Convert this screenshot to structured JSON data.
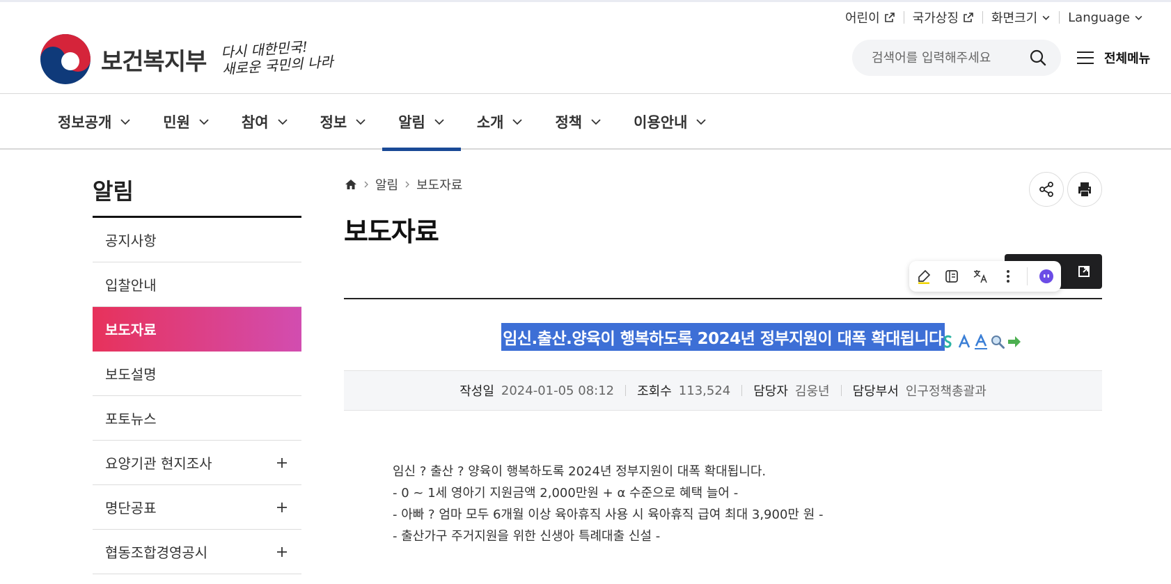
{
  "utility": {
    "kids": "어린이",
    "symbols": "국가상징",
    "screen_size": "화면크기",
    "language": "Language"
  },
  "header": {
    "org_name": "보건복지부",
    "slogan_line1": "다시 대한민국!",
    "slogan_line2": "새로운 국민의 나라",
    "search_placeholder": "검색어를 입력해주세요",
    "all_menu": "전체메뉴"
  },
  "gnb": {
    "items": [
      {
        "label": "정보공개"
      },
      {
        "label": "민원"
      },
      {
        "label": "참여"
      },
      {
        "label": "정보"
      },
      {
        "label": "알림"
      },
      {
        "label": "소개"
      },
      {
        "label": "정책"
      },
      {
        "label": "이용안내"
      }
    ],
    "active_index": 4
  },
  "sidebar": {
    "title": "알림",
    "items": [
      {
        "label": "공지사항"
      },
      {
        "label": "입찰안내"
      },
      {
        "label": "보도자료"
      },
      {
        "label": "보도설명"
      },
      {
        "label": "포토뉴스"
      },
      {
        "label": "요양기관 현지조사"
      },
      {
        "label": "명단공표"
      },
      {
        "label": "협동조합경영공시"
      }
    ],
    "active_index": 2
  },
  "breadcrumb": {
    "level1": "알림",
    "level2": "보도자료"
  },
  "page": {
    "title": "보도자료"
  },
  "article": {
    "title": "임신.출산.양육이 행복하도록 2024년 정부지원이 대폭 확대됩니다",
    "meta": {
      "date_label": "작성일",
      "date": "2024-01-05 08:12",
      "views_label": "조회수",
      "views": "113,524",
      "manager_label": "담당자",
      "manager": "김웅년",
      "dept_label": "담당부서",
      "dept": "인구정책총괄과"
    },
    "body": [
      "임신 ? 출산 ? 양육이 행복하도록 2024년 정부지원이 대폭 확대됩니다.",
      "- 0 ~ 1세 영아기 지원금액 2,000만원 + α 수준으로 혜택 늘어 -",
      "- 아빠 ? 엄마 모두 6개월 이상 육아휴직 사용 시 육아휴직 급여 최대 3,900만 원 -",
      "- 출산가구 주거지원을 위한 신생아 특례대출 신설 -"
    ]
  },
  "colors": {
    "accent_navy": "#1a4a96",
    "sidebar_active_start": "#e7325b",
    "sidebar_active_end": "#d24db0",
    "selection": "#3d6fd6"
  }
}
